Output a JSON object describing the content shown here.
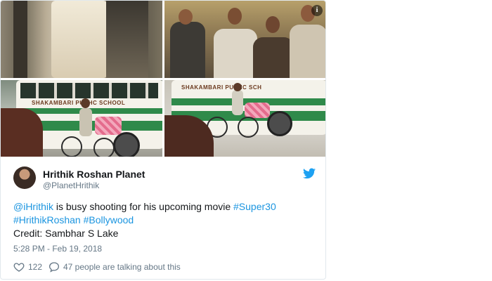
{
  "tweet": {
    "author": {
      "display_name": "Hrithik Roshan Planet",
      "handle": "@PlanetHrithik"
    },
    "text_parts": {
      "mention": "@iHrithik",
      "body": " is busy shooting for his upcoming movie ",
      "hashtag_super30": "#Super30",
      "hashtag_hrithikroshan": "#HrithikRoshan",
      "hashtag_bollywood": "#Bollywood",
      "credit": "Credit: Sambhar S Lake"
    },
    "timestamp": "5:28 PM - Feb 19, 2018",
    "likes": "122",
    "talking": "47 people are talking about this"
  },
  "media": {
    "bus_label": "SHAKAMBARI PUBHC SCHOOL",
    "bus_label_right": "SHAKAMBARI PUBHC SCH"
  },
  "colors": {
    "link": "#1b95e0",
    "twitter_blue": "#1da1f2",
    "muted": "#657786"
  },
  "icons": [
    "info-icon",
    "twitter-bird-icon",
    "heart-icon",
    "reply-bubble-icon"
  ]
}
